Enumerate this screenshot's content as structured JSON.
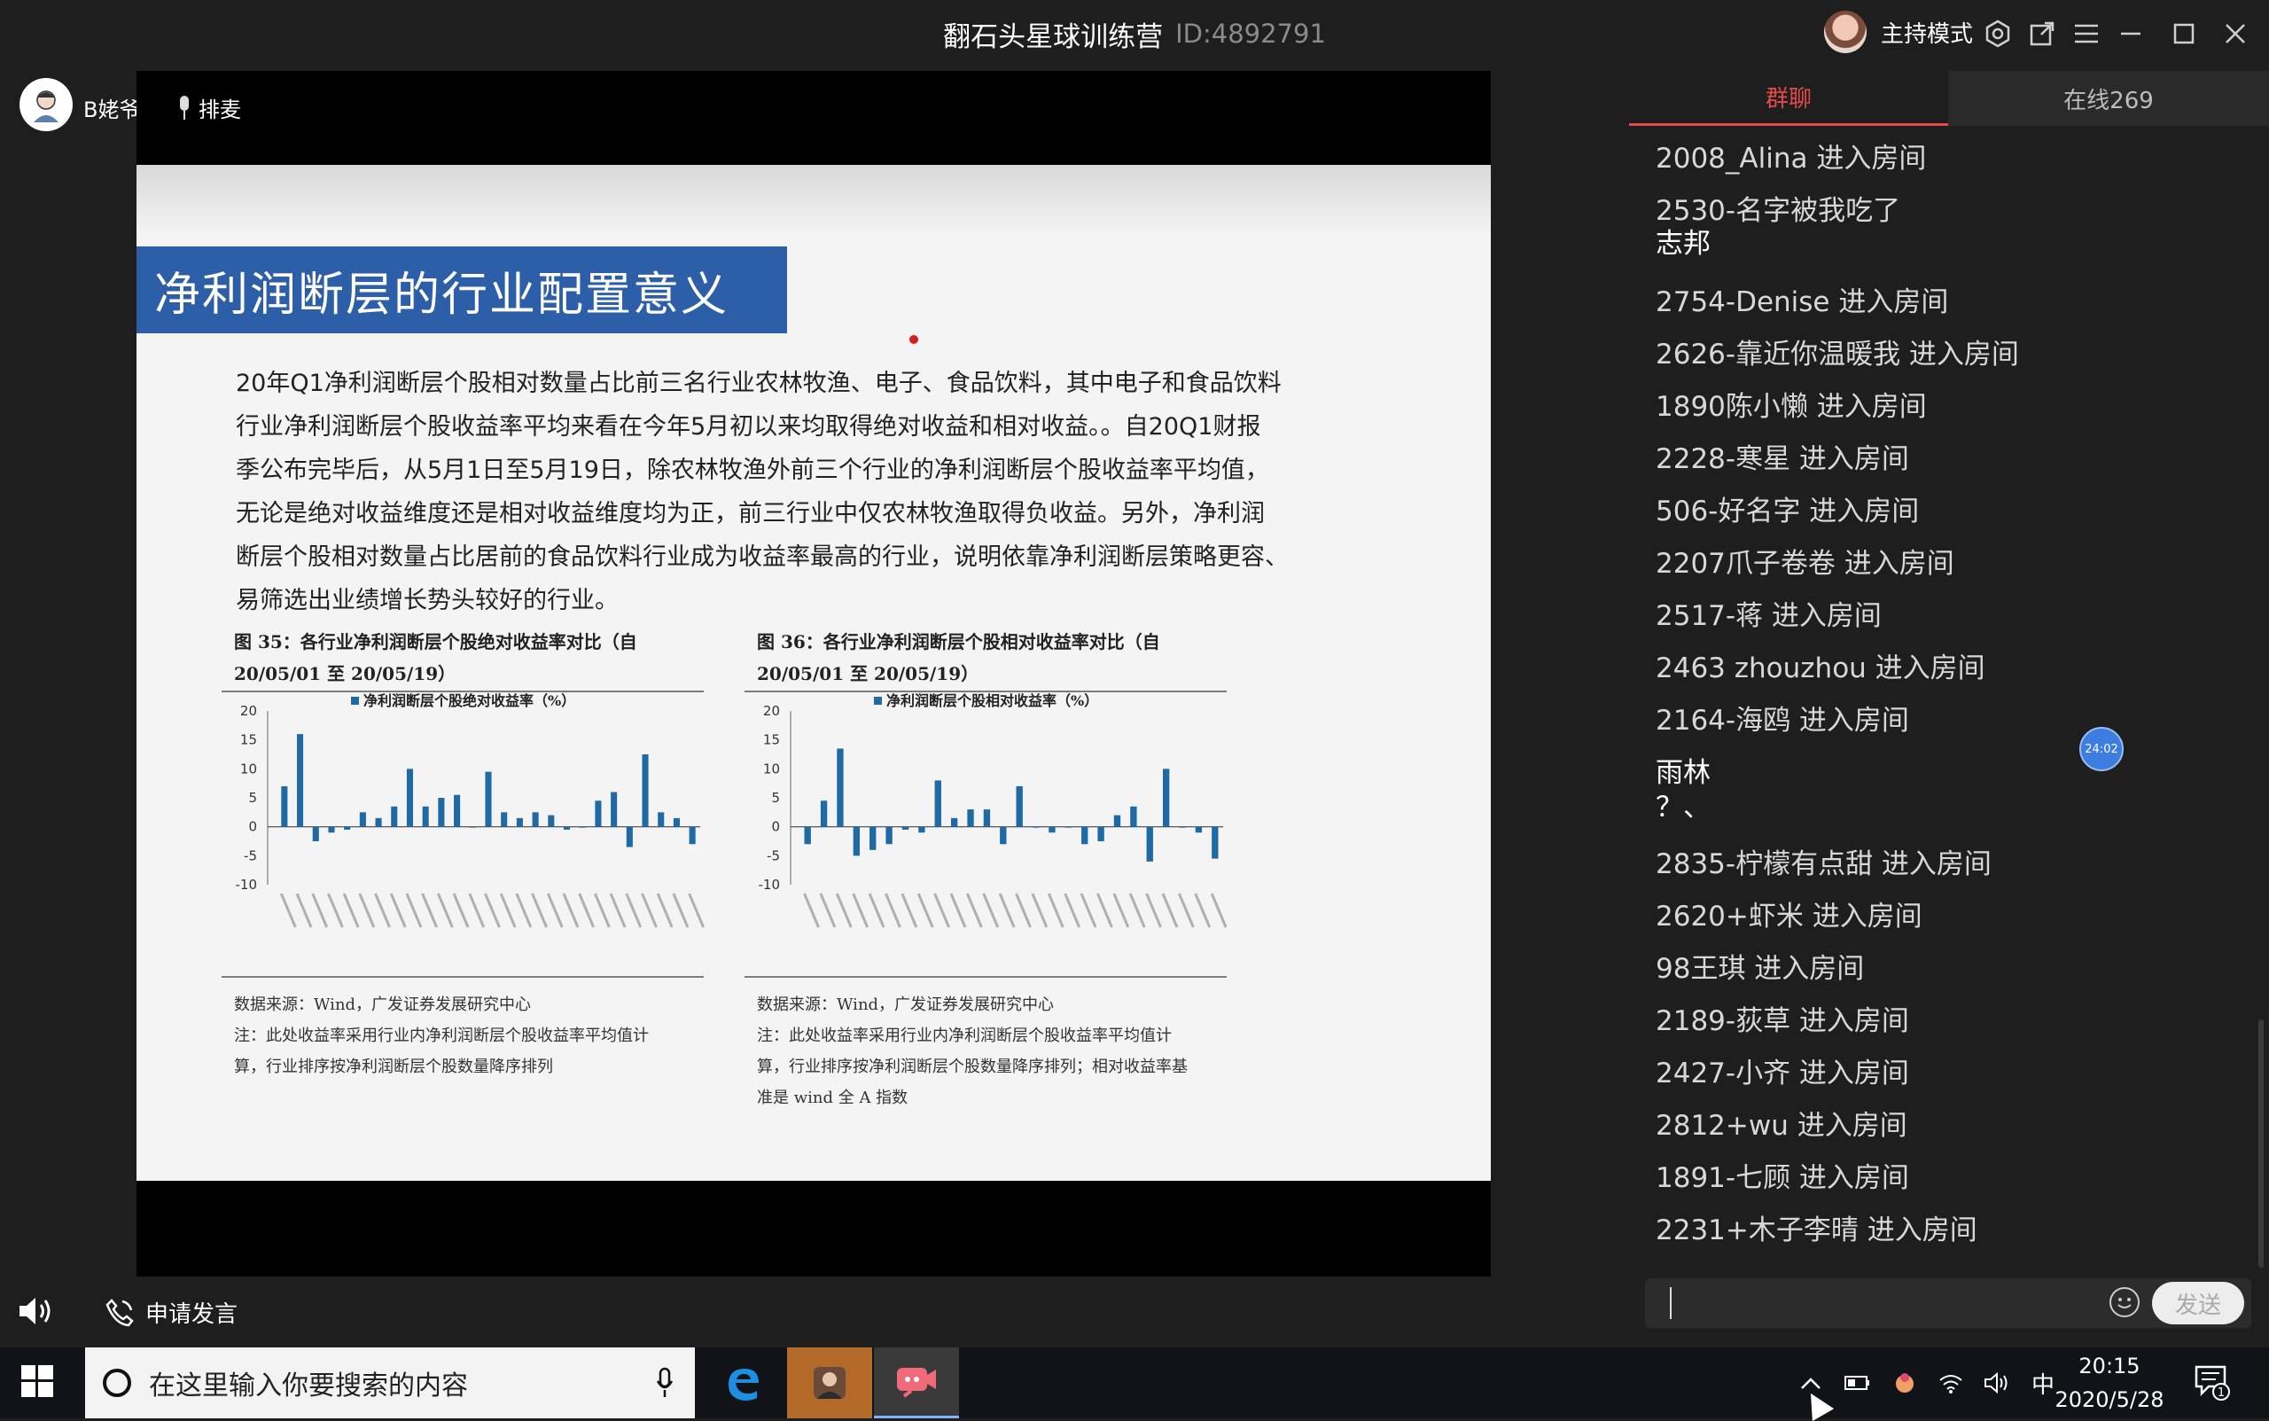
{
  "window": {
    "title": "翻石头星球训练营",
    "room_id": "ID:4892791",
    "host_mode_label": "主持模式"
  },
  "left_bar": {
    "user_name": "B姥爷",
    "mic_queue_label": "排麦",
    "apply_speak_label": "申请发言"
  },
  "slide": {
    "title": "净利润断层的行业配置意义",
    "body_lines": [
      "20年Q1净利润断层个股相对数量占比前三名行业农林牧渔、电子、食品饮料，其中电子和食品饮料",
      "行业净利润断层个股收益率平均来看在今年5月初以来均取得绝对收益和相对收益。。自20Q1财报",
      "季公布完毕后，从5月1日至5月19日，除农林牧渔外前三个行业的净利润断层个股收益率平均值，",
      "无论是绝对收益维度还是相对收益维度均为正，前三行业中仅农林牧渔取得负收益。另外，净利润",
      "断层个股相对数量占比居前的食品饮料行业成为收益率最高的行业，说明依靠净利润断层策略更容、",
      "易筛选出业绩增长势头较好的行业。"
    ],
    "figure_left": {
      "caption_line1": "图 35：各行业净利润断层个股绝对收益率对比（自",
      "caption_line2": "20/05/01 至 20/05/19）",
      "source": "数据来源：Wind，广发证券发展研究中心",
      "note_line1": "注：此处收益率采用行业内净利润断层个股收益率平均值计",
      "note_line2": "算，行业排序按净利润断层个股数量降序排列"
    },
    "figure_right": {
      "caption_line1": "图 36：各行业净利润断层个股相对收益率对比（自",
      "caption_line2": "20/05/01 至 20/05/19）",
      "source": "数据来源：Wind，广发证券发展研究中心",
      "note_line1": "注：此处收益率采用行业内净利润断层个股收益率平均值计",
      "note_line2": "算，行业排序按净利润断层个股数量降序排列；相对收益率基",
      "note_line3": "准是 wind 全 A 指数"
    }
  },
  "chart_data": [
    {
      "type": "bar",
      "title": "",
      "legend": "净利润断层个股绝对收益率（%）",
      "ylim": [
        -10,
        20
      ],
      "yticks": [
        20,
        15,
        10,
        5,
        0,
        -5,
        -10
      ],
      "values": [
        7,
        16,
        -2.5,
        -1,
        -0.5,
        2.5,
        1.5,
        3.5,
        10,
        3.5,
        5,
        5.5,
        0,
        9.5,
        2.5,
        1.5,
        2.5,
        2,
        -0.5,
        0,
        4.5,
        6,
        -3.5,
        12.5,
        2.5,
        1.5,
        -3
      ]
    },
    {
      "type": "bar",
      "title": "",
      "legend": "净利润断层个股相对收益率（%）",
      "ylim": [
        -10,
        20
      ],
      "yticks": [
        20,
        15,
        10,
        5,
        0,
        -5,
        -10
      ],
      "values": [
        -3,
        4.5,
        13.5,
        -5,
        -4,
        -3,
        -0.5,
        -1,
        8,
        1.5,
        3,
        3,
        -3,
        7,
        0,
        -1,
        0,
        -3,
        -2.5,
        2,
        3.5,
        -6,
        10,
        0,
        -1,
        -5.5
      ]
    }
  ],
  "chat": {
    "tab_group": "群聊",
    "tab_online": "在线269",
    "messages": [
      {
        "text": "2008_Alina 进入房间",
        "plain": false
      },
      {
        "text": "2530-名字被我吃了",
        "plain": false
      },
      {
        "text": "志邦",
        "plain": true
      },
      {
        "text": "2754-Denise 进入房间",
        "plain": false
      },
      {
        "text": "2626-靠近你温暖我 进入房间",
        "plain": false
      },
      {
        "text": "1890陈小懒 进入房间",
        "plain": false
      },
      {
        "text": "2228-寒星 进入房间",
        "plain": false
      },
      {
        "text": "506-好名字 进入房间",
        "plain": false
      },
      {
        "text": "2207爪子卷卷 进入房间",
        "plain": false
      },
      {
        "text": "2517-蒋 进入房间",
        "plain": false
      },
      {
        "text": "2463 zhouzhou 进入房间",
        "plain": false
      },
      {
        "text": "2164-海鸥 进入房间",
        "plain": false
      },
      {
        "text": " 雨林",
        "plain": true
      },
      {
        "text": "？、",
        "plain": true
      },
      {
        "text": "2835-柠檬有点甜 进入房间",
        "plain": false
      },
      {
        "text": "2620+虾米 进入房间",
        "plain": false
      },
      {
        "text": "98王琪 进入房间",
        "plain": false
      },
      {
        "text": "2189-荻草 进入房间",
        "plain": false
      },
      {
        "text": "2427-小齐 进入房间",
        "plain": false
      },
      {
        "text": "2812+wu 进入房间",
        "plain": false
      },
      {
        "text": "1891-七顾 进入房间",
        "plain": false
      },
      {
        "text": "2231+木子李晴 进入房间",
        "plain": false
      }
    ],
    "timer_bubble": "24:02",
    "send_label": "发送"
  },
  "taskbar": {
    "search_placeholder": "在这里输入你要搜索的内容",
    "ime": "中",
    "time": "20:15",
    "date": "2020/5/28",
    "notif_count": "1"
  },
  "colors": {
    "accent_red": "#e54a4a",
    "slide_title_blue": "#2d5ea8",
    "bar_blue": "#1f6aa5"
  }
}
